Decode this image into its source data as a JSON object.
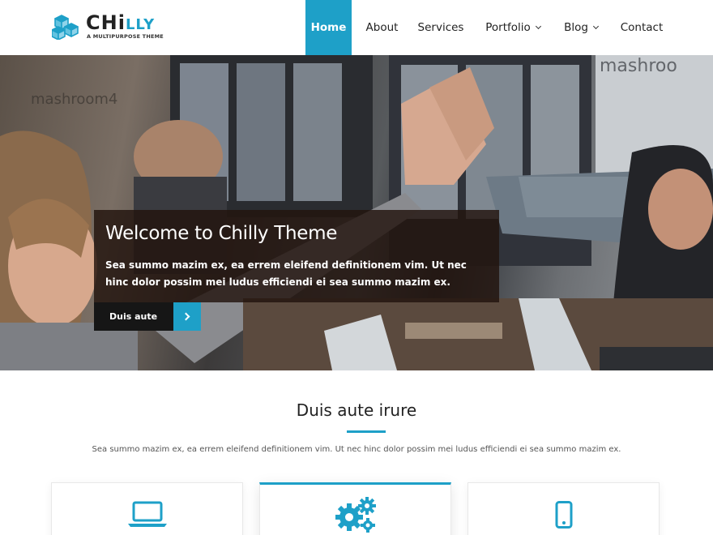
{
  "brand": {
    "title_main": "CHi",
    "title_accent": "LLY",
    "tagline": "A MULTIPURPOSE THEME",
    "logo_icon": "cubes-icon",
    "accent_color": "#1ea0c8"
  },
  "nav": {
    "items": [
      {
        "label": "Home",
        "active": true
      },
      {
        "label": "About",
        "active": false
      },
      {
        "label": "Services",
        "active": false
      },
      {
        "label": "Portfolio",
        "active": false,
        "dropdown": true
      },
      {
        "label": "Blog",
        "active": false,
        "dropdown": true
      },
      {
        "label": "Contact",
        "active": false
      }
    ]
  },
  "hero": {
    "title": "Welcome to Chilly Theme",
    "text": "Sea summo mazim ex, ea errem eleifend definitionem vim. Ut nec hinc dolor possim mei ludus efficiendi ei sea summo mazim ex.",
    "button_label": "Duis aute",
    "button_icon": "chevron-right-icon",
    "background_sign": "mashroom"
  },
  "section": {
    "title": "Duis aute irure",
    "subtitle": "Sea summo mazim ex, ea errem eleifend definitionem vim. Ut nec hinc dolor possim mei ludus efficiendi ei sea summo mazim ex."
  },
  "cards": [
    {
      "icon": "laptop-icon"
    },
    {
      "icon": "gears-icon"
    },
    {
      "icon": "mobile-icon"
    }
  ]
}
